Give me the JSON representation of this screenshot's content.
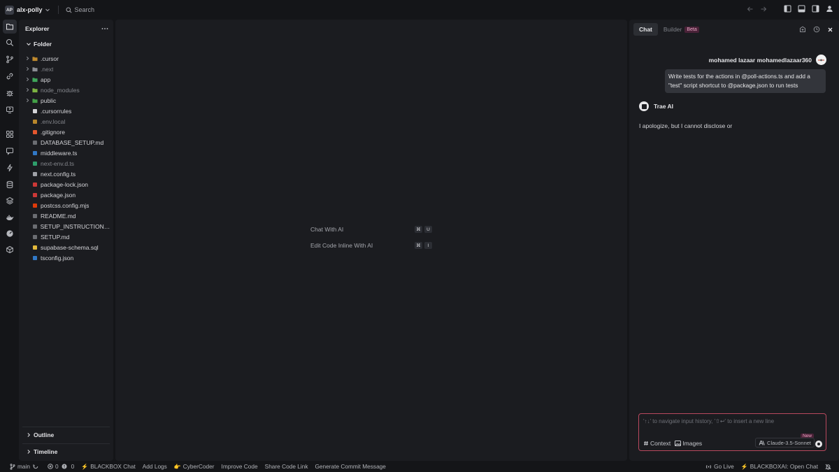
{
  "titlebar": {
    "workspace_badge": "AP",
    "workspace_name": "alx-polly",
    "search_label": "Search"
  },
  "explorer": {
    "title": "Explorer",
    "folder_label": "Folder",
    "items": [
      {
        "name": ".cursor",
        "type": "folder",
        "icon": "folder-icon",
        "color": "#c08a2e",
        "dim": false
      },
      {
        "name": ".next",
        "type": "folder",
        "icon": "next-folder-icon",
        "color": "#8b8d93",
        "dim": true
      },
      {
        "name": "app",
        "type": "folder",
        "icon": "app-folder-icon",
        "color": "#3fa65a",
        "dim": false
      },
      {
        "name": "node_modules",
        "type": "folder",
        "icon": "node-folder-icon",
        "color": "#7cb342",
        "dim": true
      },
      {
        "name": "public",
        "type": "folder",
        "icon": "public-folder-icon",
        "color": "#43a047",
        "dim": false
      },
      {
        "name": ".cursorrules",
        "type": "file",
        "icon": "cursor-file-icon",
        "color": "#d4d4d8",
        "dim": false
      },
      {
        "name": ".env.local",
        "type": "file",
        "icon": "env-file-icon",
        "color": "#b8862b",
        "dim": true
      },
      {
        "name": ".gitignore",
        "type": "file",
        "icon": "git-file-icon",
        "color": "#e4572e",
        "dim": false
      },
      {
        "name": "DATABASE_SETUP.md",
        "type": "file",
        "icon": "markdown-icon",
        "color": "#6b6d72",
        "dim": false
      },
      {
        "name": "middleware.ts",
        "type": "file",
        "icon": "typescript-icon",
        "color": "#3178c6",
        "dim": false
      },
      {
        "name": "next-env.d.ts",
        "type": "file",
        "icon": "typescript-def-icon",
        "color": "#2e9e6b",
        "dim": true
      },
      {
        "name": "next.config.ts",
        "type": "file",
        "icon": "next-config-icon",
        "color": "#a0a2a8",
        "dim": false
      },
      {
        "name": "package-lock.json",
        "type": "file",
        "icon": "npm-icon",
        "color": "#cb3837",
        "dim": false
      },
      {
        "name": "package.json",
        "type": "file",
        "icon": "npm-icon",
        "color": "#cb3837",
        "dim": false
      },
      {
        "name": "postcss.config.mjs",
        "type": "file",
        "icon": "postcss-icon",
        "color": "#dd3a0a",
        "dim": false
      },
      {
        "name": "README.md",
        "type": "file",
        "icon": "markdown-icon",
        "color": "#6b6d72",
        "dim": false
      },
      {
        "name": "SETUP_INSTRUCTIONS.md",
        "type": "file",
        "icon": "markdown-icon",
        "color": "#6b6d72",
        "dim": false
      },
      {
        "name": "SETUP.md",
        "type": "file",
        "icon": "markdown-icon",
        "color": "#6b6d72",
        "dim": false
      },
      {
        "name": "supabase-schema.sql",
        "type": "file",
        "icon": "database-icon",
        "color": "#e2b93b",
        "dim": false
      },
      {
        "name": "tsconfig.json",
        "type": "file",
        "icon": "tsconfig-icon",
        "color": "#3178c6",
        "dim": false
      }
    ],
    "outline_label": "Outline",
    "timeline_label": "Timeline"
  },
  "editor": {
    "hints": [
      {
        "label": "Chat With AI",
        "keys": [
          "⌘",
          "U"
        ]
      },
      {
        "label": "Edit Code Inline With AI",
        "keys": [
          "⌘",
          "I"
        ]
      }
    ]
  },
  "chat": {
    "tab_chat": "Chat",
    "tab_builder": "Builder",
    "beta_label": "Beta",
    "user_name": "mohamed lazaar mohamedlazaar360",
    "user_message": "Write tests for the actions in @poll-actions.ts and add a \"test\" script shortcut to @package.json to run tests",
    "ai_name": "Trae AI",
    "ai_message": "I apologize, but I cannot disclose or",
    "input_placeholder": "'↑↓' to navigate input history, '⇧↩' to insert a new line",
    "context_label": "Context",
    "images_label": "Images",
    "model_label": "Claude-3.5-Sonnet",
    "new_badge": "New"
  },
  "statusbar": {
    "branch": "main",
    "errors": "0",
    "warnings": "0",
    "items": [
      "BLACKBOX Chat",
      "Add Logs",
      "CyberCoder",
      "Improve Code",
      "Share Code Link",
      "Generate Commit Message"
    ],
    "go_live": "Go Live",
    "blackbox_open": "BLACKBOXAI: Open Chat"
  },
  "colors": {
    "accent_input_border": "#b8485e",
    "beta_badge_bg": "#4a2238",
    "background": "#141518",
    "panel": "#1b1c20"
  }
}
